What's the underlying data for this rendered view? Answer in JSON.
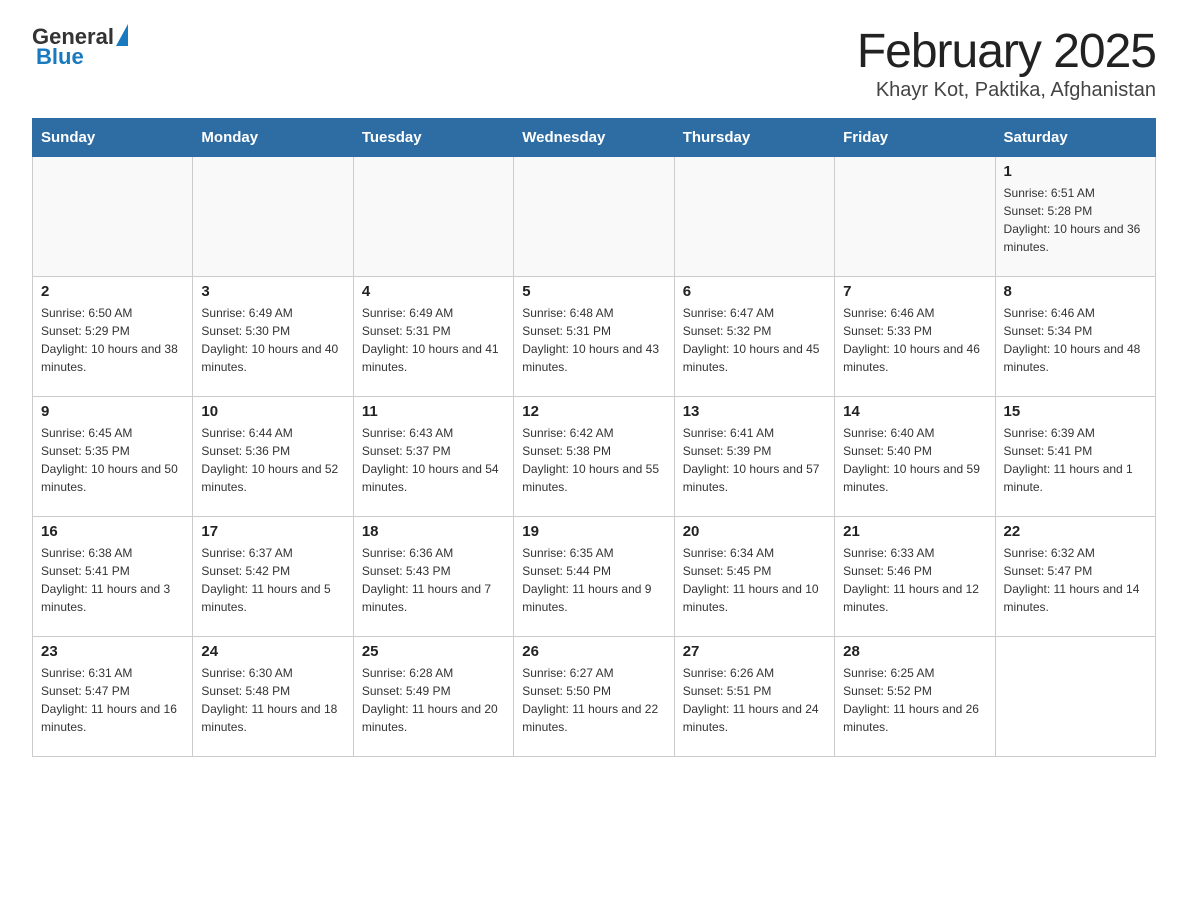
{
  "logo": {
    "general": "General",
    "blue": "Blue"
  },
  "header": {
    "month_year": "February 2025",
    "location": "Khayr Kot, Paktika, Afghanistan"
  },
  "days_of_week": [
    "Sunday",
    "Monday",
    "Tuesday",
    "Wednesday",
    "Thursday",
    "Friday",
    "Saturday"
  ],
  "weeks": [
    [
      null,
      null,
      null,
      null,
      null,
      null,
      {
        "day": "1",
        "sunrise": "Sunrise: 6:51 AM",
        "sunset": "Sunset: 5:28 PM",
        "daylight": "Daylight: 10 hours and 36 minutes."
      }
    ],
    [
      {
        "day": "2",
        "sunrise": "Sunrise: 6:50 AM",
        "sunset": "Sunset: 5:29 PM",
        "daylight": "Daylight: 10 hours and 38 minutes."
      },
      {
        "day": "3",
        "sunrise": "Sunrise: 6:49 AM",
        "sunset": "Sunset: 5:30 PM",
        "daylight": "Daylight: 10 hours and 40 minutes."
      },
      {
        "day": "4",
        "sunrise": "Sunrise: 6:49 AM",
        "sunset": "Sunset: 5:31 PM",
        "daylight": "Daylight: 10 hours and 41 minutes."
      },
      {
        "day": "5",
        "sunrise": "Sunrise: 6:48 AM",
        "sunset": "Sunset: 5:31 PM",
        "daylight": "Daylight: 10 hours and 43 minutes."
      },
      {
        "day": "6",
        "sunrise": "Sunrise: 6:47 AM",
        "sunset": "Sunset: 5:32 PM",
        "daylight": "Daylight: 10 hours and 45 minutes."
      },
      {
        "day": "7",
        "sunrise": "Sunrise: 6:46 AM",
        "sunset": "Sunset: 5:33 PM",
        "daylight": "Daylight: 10 hours and 46 minutes."
      },
      {
        "day": "8",
        "sunrise": "Sunrise: 6:46 AM",
        "sunset": "Sunset: 5:34 PM",
        "daylight": "Daylight: 10 hours and 48 minutes."
      }
    ],
    [
      {
        "day": "9",
        "sunrise": "Sunrise: 6:45 AM",
        "sunset": "Sunset: 5:35 PM",
        "daylight": "Daylight: 10 hours and 50 minutes."
      },
      {
        "day": "10",
        "sunrise": "Sunrise: 6:44 AM",
        "sunset": "Sunset: 5:36 PM",
        "daylight": "Daylight: 10 hours and 52 minutes."
      },
      {
        "day": "11",
        "sunrise": "Sunrise: 6:43 AM",
        "sunset": "Sunset: 5:37 PM",
        "daylight": "Daylight: 10 hours and 54 minutes."
      },
      {
        "day": "12",
        "sunrise": "Sunrise: 6:42 AM",
        "sunset": "Sunset: 5:38 PM",
        "daylight": "Daylight: 10 hours and 55 minutes."
      },
      {
        "day": "13",
        "sunrise": "Sunrise: 6:41 AM",
        "sunset": "Sunset: 5:39 PM",
        "daylight": "Daylight: 10 hours and 57 minutes."
      },
      {
        "day": "14",
        "sunrise": "Sunrise: 6:40 AM",
        "sunset": "Sunset: 5:40 PM",
        "daylight": "Daylight: 10 hours and 59 minutes."
      },
      {
        "day": "15",
        "sunrise": "Sunrise: 6:39 AM",
        "sunset": "Sunset: 5:41 PM",
        "daylight": "Daylight: 11 hours and 1 minute."
      }
    ],
    [
      {
        "day": "16",
        "sunrise": "Sunrise: 6:38 AM",
        "sunset": "Sunset: 5:41 PM",
        "daylight": "Daylight: 11 hours and 3 minutes."
      },
      {
        "day": "17",
        "sunrise": "Sunrise: 6:37 AM",
        "sunset": "Sunset: 5:42 PM",
        "daylight": "Daylight: 11 hours and 5 minutes."
      },
      {
        "day": "18",
        "sunrise": "Sunrise: 6:36 AM",
        "sunset": "Sunset: 5:43 PM",
        "daylight": "Daylight: 11 hours and 7 minutes."
      },
      {
        "day": "19",
        "sunrise": "Sunrise: 6:35 AM",
        "sunset": "Sunset: 5:44 PM",
        "daylight": "Daylight: 11 hours and 9 minutes."
      },
      {
        "day": "20",
        "sunrise": "Sunrise: 6:34 AM",
        "sunset": "Sunset: 5:45 PM",
        "daylight": "Daylight: 11 hours and 10 minutes."
      },
      {
        "day": "21",
        "sunrise": "Sunrise: 6:33 AM",
        "sunset": "Sunset: 5:46 PM",
        "daylight": "Daylight: 11 hours and 12 minutes."
      },
      {
        "day": "22",
        "sunrise": "Sunrise: 6:32 AM",
        "sunset": "Sunset: 5:47 PM",
        "daylight": "Daylight: 11 hours and 14 minutes."
      }
    ],
    [
      {
        "day": "23",
        "sunrise": "Sunrise: 6:31 AM",
        "sunset": "Sunset: 5:47 PM",
        "daylight": "Daylight: 11 hours and 16 minutes."
      },
      {
        "day": "24",
        "sunrise": "Sunrise: 6:30 AM",
        "sunset": "Sunset: 5:48 PM",
        "daylight": "Daylight: 11 hours and 18 minutes."
      },
      {
        "day": "25",
        "sunrise": "Sunrise: 6:28 AM",
        "sunset": "Sunset: 5:49 PM",
        "daylight": "Daylight: 11 hours and 20 minutes."
      },
      {
        "day": "26",
        "sunrise": "Sunrise: 6:27 AM",
        "sunset": "Sunset: 5:50 PM",
        "daylight": "Daylight: 11 hours and 22 minutes."
      },
      {
        "day": "27",
        "sunrise": "Sunrise: 6:26 AM",
        "sunset": "Sunset: 5:51 PM",
        "daylight": "Daylight: 11 hours and 24 minutes."
      },
      {
        "day": "28",
        "sunrise": "Sunrise: 6:25 AM",
        "sunset": "Sunset: 5:52 PM",
        "daylight": "Daylight: 11 hours and 26 minutes."
      },
      null
    ]
  ]
}
